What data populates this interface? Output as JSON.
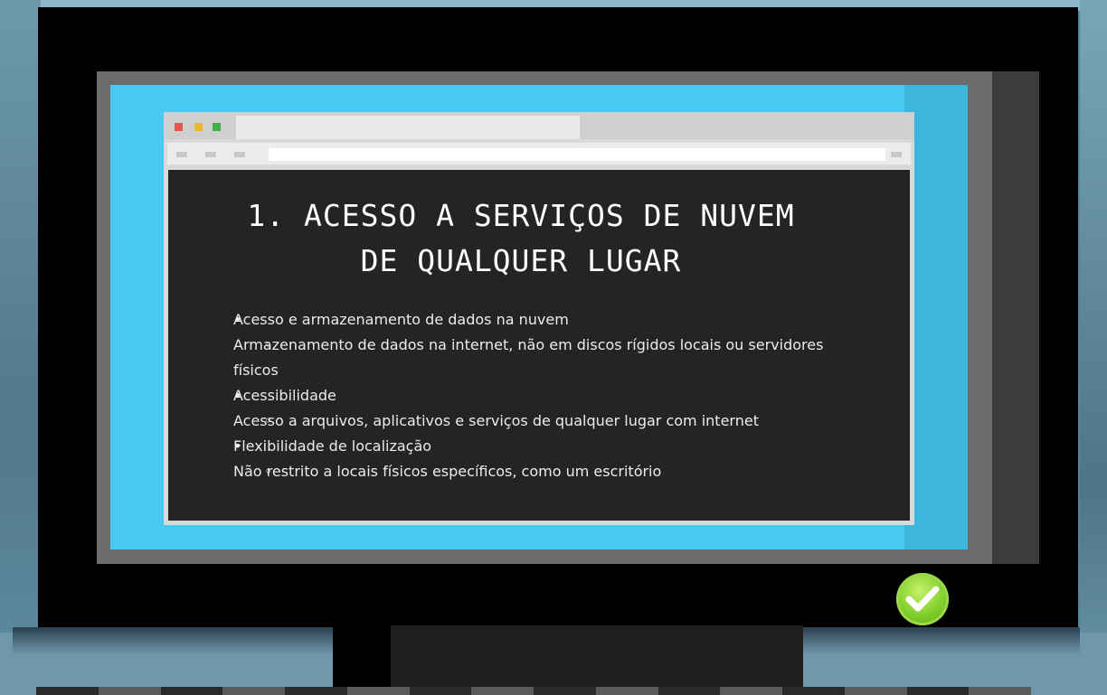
{
  "slide": {
    "title_line1": "1. ACESSO A SERVIÇOS DE NUVEM",
    "title_line2": "DE QUALQUER LUGAR",
    "bullets": [
      "Acesso e armazenamento de dados na nuvem",
      "Armazenamento de dados na internet, não em discos rígidos locais ou servidores físicos",
      "Acessibilidade",
      "Acesso a arquivos, aplicativos e serviços de qualquer lugar com internet",
      "Flexibilidade de localização",
      "Não restrito a locais físicos específicos, como um escritório"
    ]
  },
  "icons": {
    "check": "check-circle-icon",
    "window_controls": [
      "close-dot",
      "minimize-dot",
      "maximize-dot"
    ]
  },
  "colors": {
    "screen": "#49c9f2",
    "slide_bg": "#242424",
    "check": "#7fcf2a"
  }
}
